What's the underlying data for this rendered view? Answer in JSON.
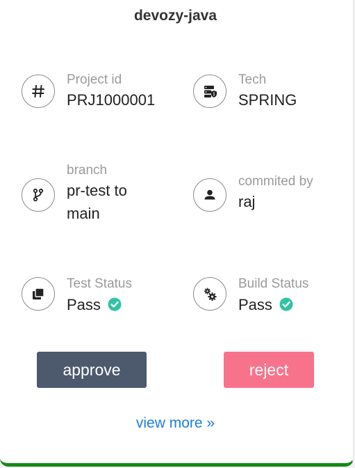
{
  "card": {
    "title": "devozy-java",
    "fields": {
      "project_id": {
        "label": "Project id",
        "value": "PRJ1000001",
        "icon": "hash-icon"
      },
      "tech": {
        "label": "Tech",
        "value": "SPRING",
        "icon": "server-icon"
      },
      "branch": {
        "label": "branch",
        "value": "pr-test to main",
        "icon": "code-branch-icon"
      },
      "commited_by": {
        "label": "commited by",
        "value": "raj",
        "icon": "user-icon"
      },
      "test_status": {
        "label": "Test Status",
        "value": "Pass",
        "icon": "layers-icon",
        "status_icon": "check-circle-icon"
      },
      "build_status": {
        "label": "Build Status",
        "value": "Pass",
        "icon": "gears-icon",
        "status_icon": "check-circle-icon"
      }
    },
    "actions": {
      "approve_label": "approve",
      "reject_label": "reject",
      "view_more_label": "view more »"
    }
  },
  "colors": {
    "approve": "#4d5a6e",
    "reject": "#f7738c",
    "link": "#1a7fd8",
    "pass": "#2ec4a6",
    "bottom_border": "#138a13"
  }
}
